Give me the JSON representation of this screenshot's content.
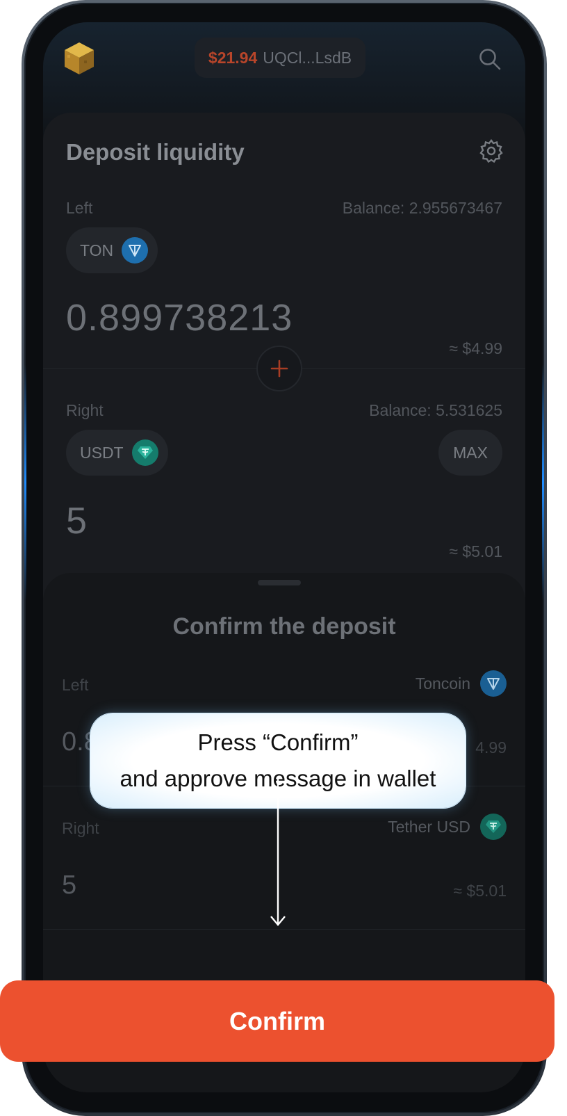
{
  "header": {
    "balance_amount": "$21.94",
    "wallet_address": "UQCl...LsdB",
    "logo_icon": "gold-cube-logo",
    "search_icon": "search-icon"
  },
  "deposit_card": {
    "title": "Deposit liquidity",
    "left": {
      "label": "Left",
      "balance": "Balance: 2.955673467",
      "token": "TON",
      "amount": "0.899738213",
      "usd_value": "≈ $4.99"
    },
    "right": {
      "label": "Right",
      "balance": "Balance: 5.531625",
      "token": "USDT",
      "max_label": "MAX",
      "amount": "5",
      "usd_value": "≈ $5.01"
    }
  },
  "confirm_sheet": {
    "title": "Confirm the deposit",
    "left": {
      "label": "Left",
      "token_name": "Toncoin",
      "amount": "0.8",
      "usd_value": "4.99"
    },
    "right": {
      "label": "Right",
      "token_name": "Tether USD",
      "amount": "5",
      "usd_value": "≈ $5.01"
    }
  },
  "callout": {
    "line1": "Press “Confirm”",
    "line2": "and approve message in wallet"
  },
  "confirm_button": {
    "label": "Confirm"
  },
  "colors": {
    "accent": "#ec512f",
    "ton_blue": "#1e7fc4",
    "usdt_green": "#1a9a86",
    "balance_red": "#b8452a"
  }
}
